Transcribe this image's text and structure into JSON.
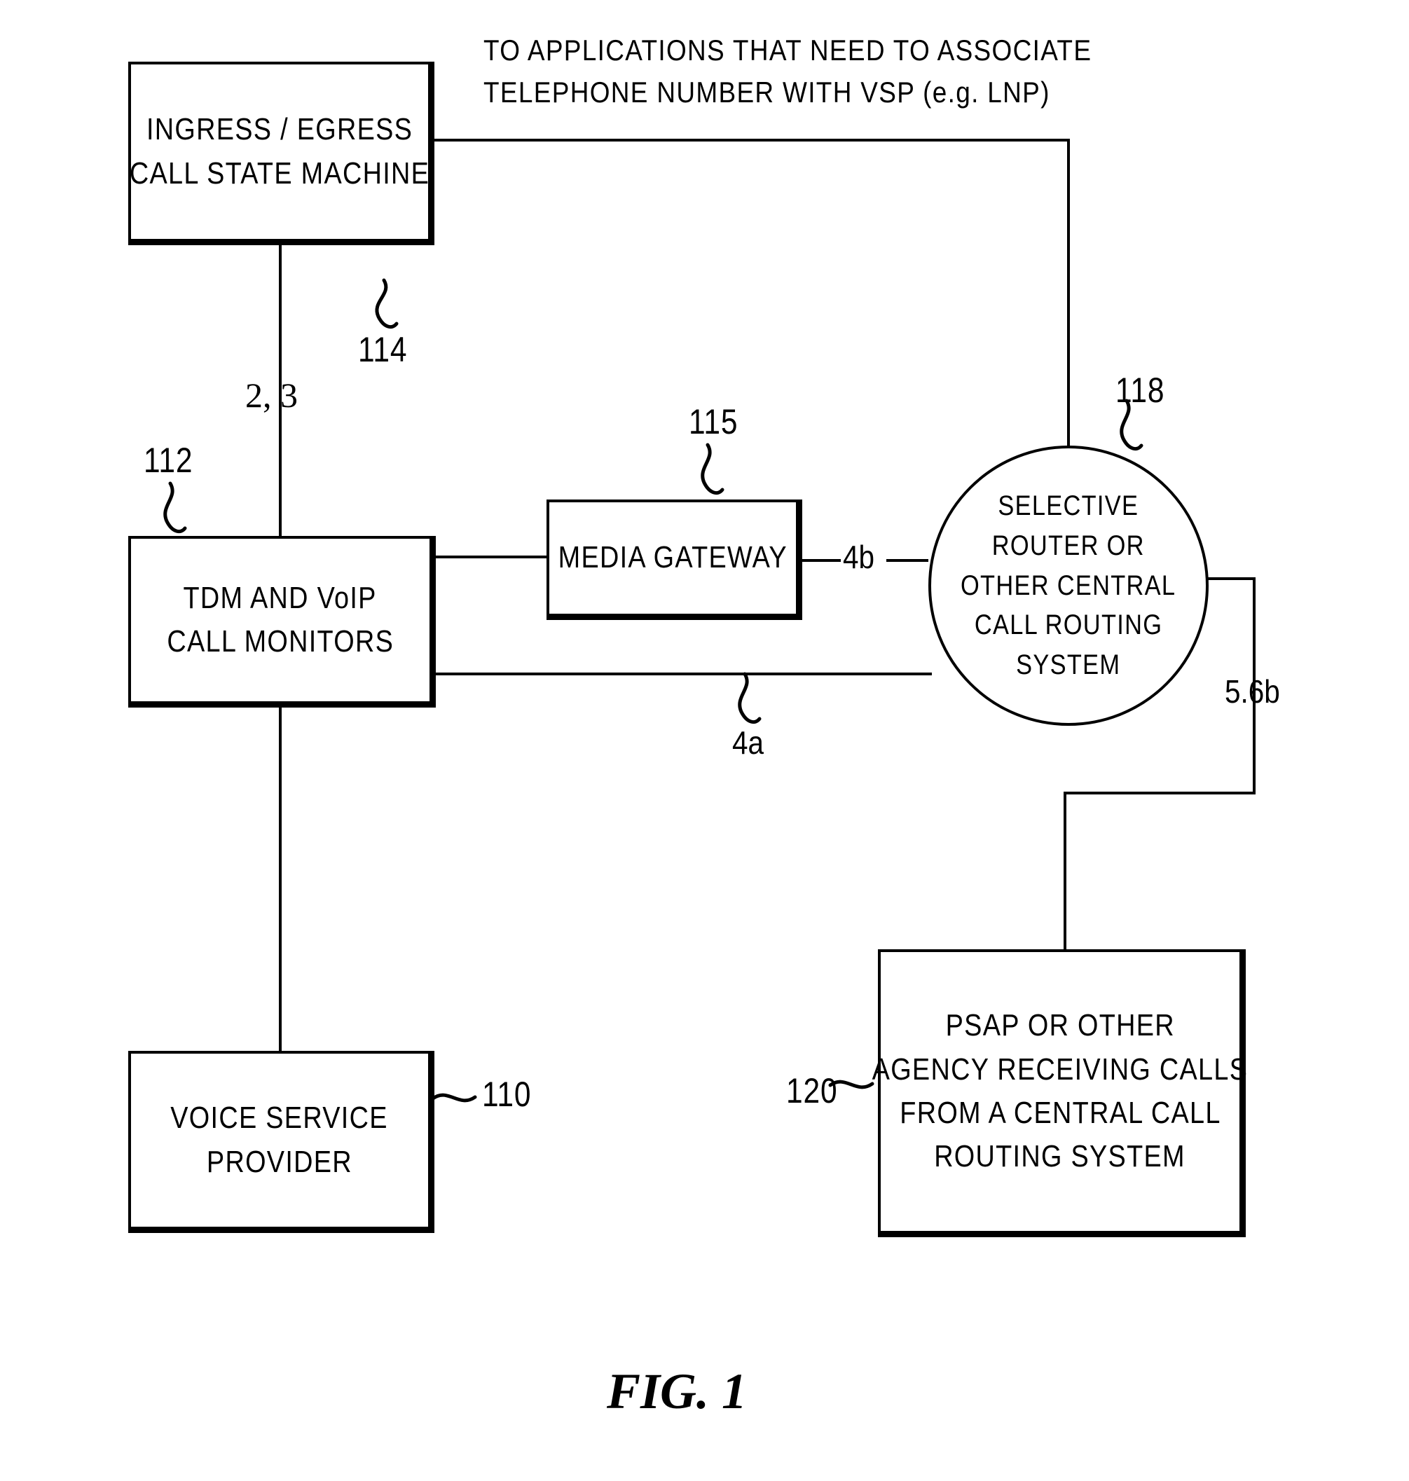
{
  "figure": {
    "caption": "FIG.  1",
    "header_note": {
      "line1": "TO APPLICATIONS THAT NEED TO ASSOCIATE",
      "line2": "TELEPHONE NUMBER WITH VSP (e.g. LNP)"
    }
  },
  "nodes": {
    "call_state_machine": {
      "line1": "INGRESS / EGRESS",
      "line2": "CALL STATE MACHINE",
      "ref": "114"
    },
    "call_monitors": {
      "line1": "TDM AND VoIP",
      "line2": "CALL MONITORS",
      "ref": "112"
    },
    "media_gateway": {
      "line1": "MEDIA GATEWAY",
      "ref": "115"
    },
    "selective_router": {
      "line1": "SELECTIVE",
      "line2": "ROUTER OR",
      "line3": "OTHER CENTRAL",
      "line4": "CALL ROUTING",
      "line5": "SYSTEM",
      "ref": "118"
    },
    "voice_service_provider": {
      "line1": "VOICE SERVICE",
      "line2": "PROVIDER",
      "ref": "110"
    },
    "psap": {
      "line1": "PSAP OR OTHER",
      "line2": "AGENCY RECEIVING CALLS",
      "line3": "FROM A CENTRAL CALL",
      "line4": "ROUTING SYSTEM",
      "ref": "120"
    }
  },
  "flows": {
    "state_machine_to_monitors": "2, 3",
    "monitors_to_router_direct": "4a",
    "gateway_to_router": "4b",
    "router_to_psap": "5.6b"
  },
  "colors": {
    "ink": "#000000",
    "paper": "#ffffff"
  }
}
